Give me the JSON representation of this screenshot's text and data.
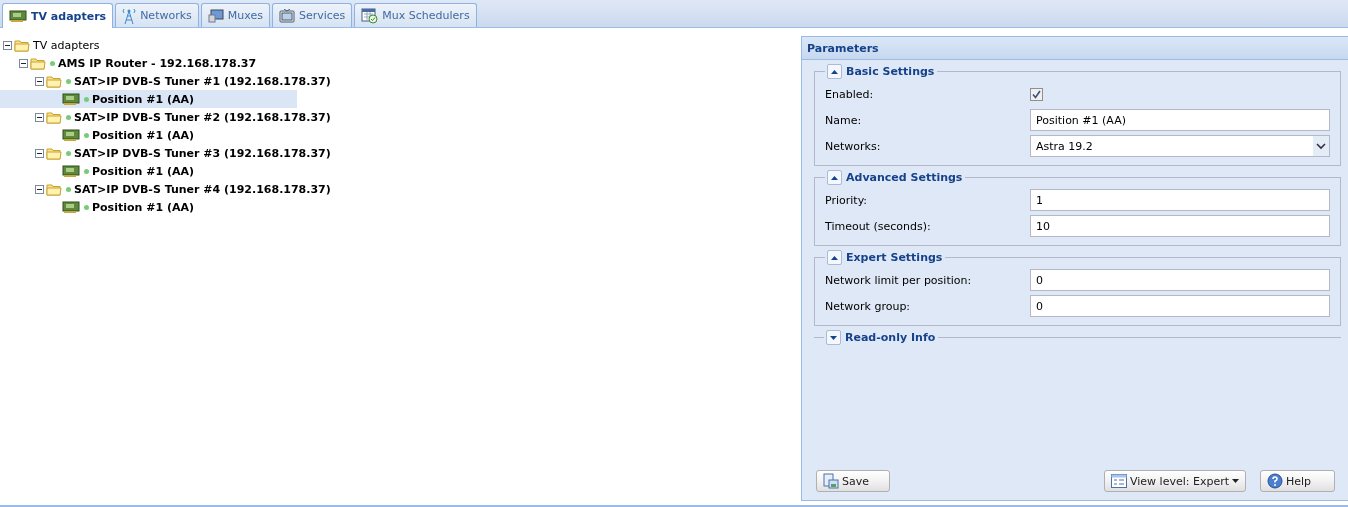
{
  "tabs": [
    {
      "label": "TV adapters",
      "selected": true
    },
    {
      "label": "Networks",
      "selected": false
    },
    {
      "label": "Muxes",
      "selected": false
    },
    {
      "label": "Services",
      "selected": false
    },
    {
      "label": "Mux Schedulers",
      "selected": false
    }
  ],
  "tree": [
    {
      "label": "TV adapters",
      "kind": "folder",
      "online": false,
      "expanded": true,
      "selected": false,
      "children": [
        {
          "label": "AMS IP Router - 192.168.178.37",
          "kind": "folder",
          "online": true,
          "expanded": true,
          "selected": false,
          "children": [
            {
              "label": "SAT>IP DVB-S Tuner #1 (192.168.178.37)",
              "kind": "folder",
              "online": true,
              "expanded": true,
              "selected": false,
              "children": [
                {
                  "label": "Position #1 (AA)",
                  "kind": "card",
                  "online": true,
                  "selected": true
                }
              ]
            },
            {
              "label": "SAT>IP DVB-S Tuner #2 (192.168.178.37)",
              "kind": "folder",
              "online": true,
              "expanded": true,
              "selected": false,
              "children": [
                {
                  "label": "Position #1 (AA)",
                  "kind": "card",
                  "online": true,
                  "selected": false
                }
              ]
            },
            {
              "label": "SAT>IP DVB-S Tuner #3 (192.168.178.37)",
              "kind": "folder",
              "online": true,
              "expanded": true,
              "selected": false,
              "children": [
                {
                  "label": "Position #1 (AA)",
                  "kind": "card",
                  "online": true,
                  "selected": false
                }
              ]
            },
            {
              "label": "SAT>IP DVB-S Tuner #4 (192.168.178.37)",
              "kind": "folder",
              "online": true,
              "expanded": true,
              "selected": false,
              "children": [
                {
                  "label": "Position #1 (AA)",
                  "kind": "card",
                  "online": true,
                  "selected": false
                }
              ]
            }
          ]
        }
      ]
    }
  ],
  "parameters": {
    "title": "Parameters",
    "sections": [
      {
        "title": "Basic Settings",
        "expanded": true,
        "fields": [
          {
            "label": "Enabled:",
            "kind": "checkbox",
            "checked": true
          },
          {
            "label": "Name:",
            "kind": "text",
            "value": "Position #1 (AA)"
          },
          {
            "label": "Networks:",
            "kind": "select",
            "value": "Astra 19.2"
          }
        ]
      },
      {
        "title": "Advanced Settings",
        "expanded": true,
        "fields": [
          {
            "label": "Priority:",
            "kind": "text",
            "value": "1"
          },
          {
            "label": "Timeout (seconds):",
            "kind": "text",
            "value": "10"
          }
        ]
      },
      {
        "title": "Expert Settings",
        "expanded": true,
        "fields": [
          {
            "label": "Network limit per position:",
            "kind": "text",
            "value": "0"
          },
          {
            "label": "Network group:",
            "kind": "text",
            "value": "0"
          }
        ]
      },
      {
        "title": "Read-only Info",
        "expanded": false
      }
    ],
    "buttons": {
      "save": "Save",
      "view_level": "View level: Expert",
      "help": "Help"
    }
  }
}
